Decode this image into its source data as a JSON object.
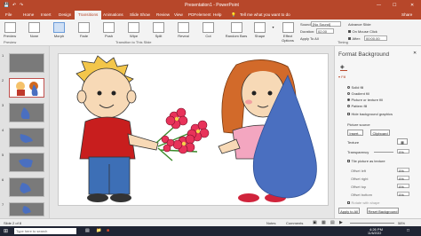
{
  "titlebar": {
    "doc_title": "Presentation1 - PowerPoint",
    "tell_me": "Tell me what you want to do",
    "share": "Share"
  },
  "tabs": [
    "File",
    "Home",
    "Insert",
    "Design",
    "Transitions",
    "Animations",
    "Slide Show",
    "Review",
    "View",
    "PDFelement",
    "Help"
  ],
  "ribbon": {
    "preview_label": "Preview",
    "transitions": [
      "None",
      "Morph",
      "Fade",
      "Push",
      "Wipe",
      "Split",
      "Reveal",
      "Cut",
      "Random Bars",
      "Shape"
    ],
    "effect_options": "Effect Options",
    "sound_label": "Sound:",
    "sound_value": "[No Sound]",
    "duration_label": "Duration:",
    "duration_value": "02.00",
    "apply_to_all": "Apply To All",
    "advance_slide": "Advance Slide",
    "on_mouse_click": "On Mouse Click",
    "after_label": "After:",
    "after_value": "00:00.00",
    "group_preview": "Preview",
    "group_transition": "Transition to This Slide",
    "group_timing": "Timing"
  },
  "slides": {
    "numbers": [
      "1",
      "2",
      "3",
      "4",
      "5",
      "6",
      "7",
      "8"
    ],
    "selected": 2
  },
  "format_pane": {
    "title": "Format Background",
    "fill_header": "Fill",
    "solid_fill": "Solid fill",
    "gradient_fill": "Gradient fill",
    "picture_fill": "Picture or texture fill",
    "pattern_fill": "Pattern fill",
    "hide_graphics": "Hide background graphics",
    "picture_source": "Picture source",
    "insert_btn": "Insert...",
    "clipboard_btn": "Clipboard",
    "texture": "Texture",
    "transparency": "Transparency",
    "transparency_value": "0%",
    "tile_picture": "Tile picture as texture",
    "offset_left": "Offset left",
    "offset_right": "Offset right",
    "offset_top": "Offset top",
    "offset_bottom": "Offset bottom",
    "offset_values": [
      "0%",
      "0%",
      "0%",
      "0%"
    ],
    "rotate_with_shape": "Rotate with shape",
    "apply_to_all": "Apply to All",
    "reset_background": "Reset Background"
  },
  "statusbar": {
    "slide_info": "Slide 2 of 8",
    "notes": "Notes",
    "comments": "Comments",
    "zoom": "58%"
  },
  "taskbar": {
    "search_placeholder": "Type here to search",
    "time": "4:26 PM",
    "date": "11/6/2022"
  }
}
